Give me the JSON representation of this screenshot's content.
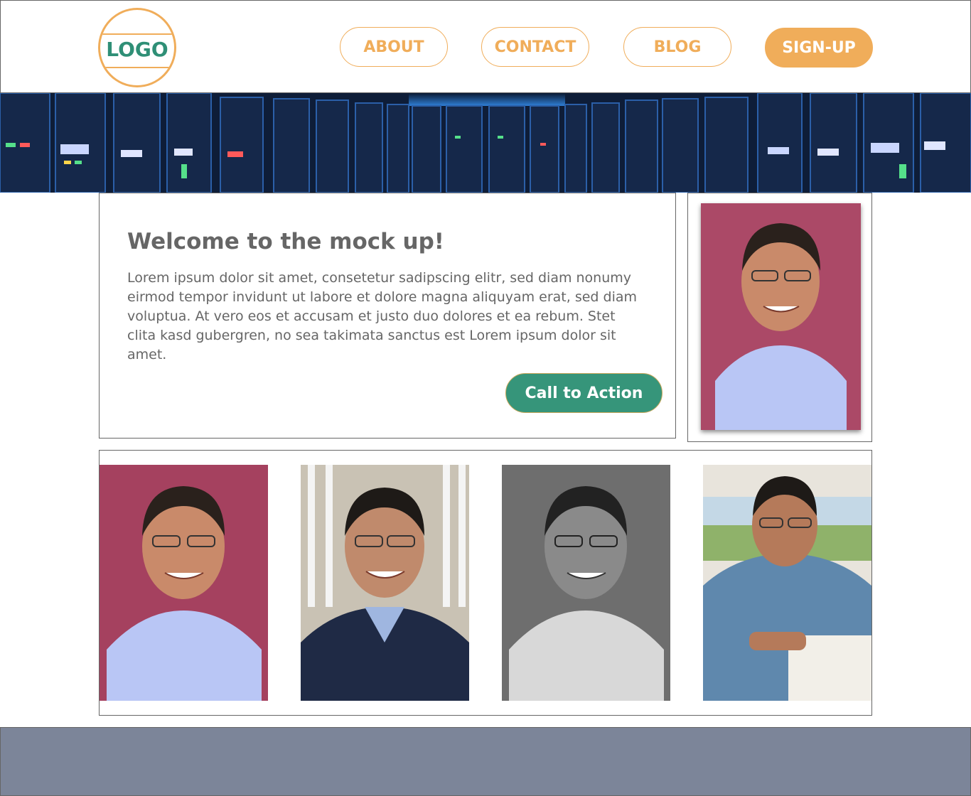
{
  "header": {
    "logo_text": "LOGO",
    "nav": {
      "about": "ABOUT",
      "contact": "CONTACT",
      "blog": "BLOG",
      "signup": "SIGN-UP"
    }
  },
  "welcome": {
    "title": "Welcome to the mock up!",
    "body": "Lorem ipsum dolor sit amet, consetetur sadipscing elitr, sed diam nonumy eirmod tempor invidunt ut labore et dolore magna aliquyam erat, sed diam voluptua. At vero eos et accusam et justo duo dolores et ea rebum. Stet clita kasd gubergren, no sea takimata sanctus est Lorem ipsum dolor sit amet.",
    "cta_label": "Call to Action"
  },
  "colors": {
    "accent_orange": "#f0ad5a",
    "accent_green": "#36957a",
    "text_gray": "#666666",
    "footer_bg": "#7c8599"
  }
}
